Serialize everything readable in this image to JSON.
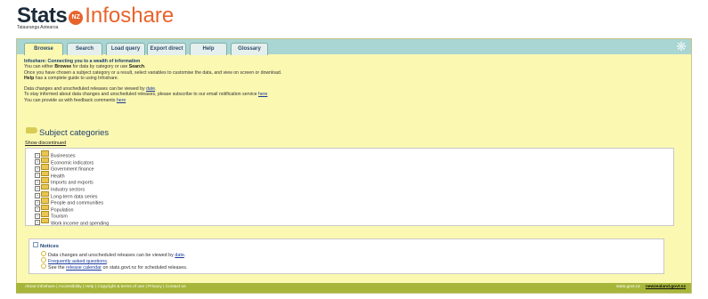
{
  "logo": {
    "stats": "Stats",
    "nz": "NZ",
    "infoshare": "Infoshare",
    "tagline": "Tatauranga Aotearoa"
  },
  "tabs": [
    {
      "label": "Browse",
      "active": true
    },
    {
      "label": "Search",
      "active": false
    },
    {
      "label": "Load query",
      "active": false
    },
    {
      "label": "Export direct",
      "active": false
    },
    {
      "label": "Help",
      "active": false
    },
    {
      "label": "Glossary",
      "active": false
    }
  ],
  "intro": {
    "heading": "Infoshare: Connecting you to a wealth of information",
    "l1_a": "You can either ",
    "l1_browse": "Browse",
    "l1_b": " for data by category or use ",
    "l1_search": "Search",
    "l1_c": ".",
    "l2": "Once you have chosen a subject category or a result, select variables to customise the data, and view on screen or download.",
    "l3_help": "Help",
    "l3_b": " has a complete guide to using Infoshare.",
    "l4_a": "Data changes and unscheduled releases can be viewed by ",
    "l4_link": "date",
    "l4_b": ".",
    "l5_a": "To stay informed about data changes and unscheduled releases, please subscribe to our email notification service ",
    "l5_link": "here",
    "l6_a": "You can provide us with feedback comments ",
    "l6_link": "here"
  },
  "subject": {
    "title": "Subject categories",
    "show_discontinued": "Show discontinued"
  },
  "categories": [
    "Businesses",
    "Economic indicators",
    "Government finance",
    "Health",
    "Imports and exports",
    "Industry sectors",
    "Long-term data series",
    "People and communities",
    "Population",
    "Tourism",
    "Work income and spending"
  ],
  "notices": {
    "title": "Notices",
    "n1_a": "Data changes and unscheduled releases can be viewed by ",
    "n1_link": "date",
    "n1_b": ".",
    "n2_link": "Frequently asked questions",
    "n2_b": ".",
    "n3_a": "See the ",
    "n3_link": "release calendar",
    "n3_b": " on stats.govt.nz for scheduled releases."
  },
  "footer": {
    "links": "About Infoshare | Accessibility | Help | Copyright & terms of use | Privacy | Contact us",
    "site": "stats.govt.nz",
    "nzgovt": "newzealand.govt.nz"
  },
  "colors": {
    "panel": "#fbf8b2",
    "tabbar": "#a9d5d2",
    "footer": "#a7b63a",
    "brand_orange": "#e8632b"
  }
}
